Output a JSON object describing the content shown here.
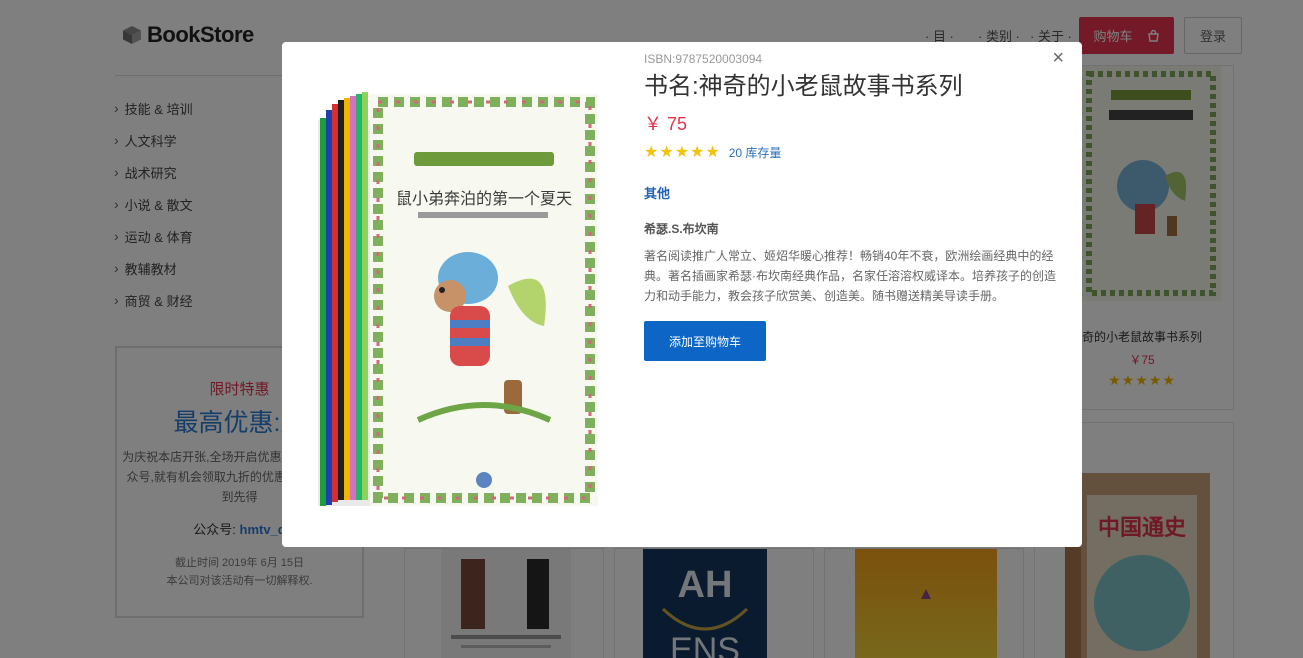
{
  "header": {
    "logo_text": "BookStore",
    "nav_items": [
      "· 目 ·",
      "· 类别 ·",
      "· 关于 ·"
    ],
    "cart_label": "购物车",
    "login_label": "登录"
  },
  "sidebar": {
    "categories": [
      "技能 & 培训",
      "人文科学",
      "战术研究",
      "小说 & 散文",
      "运动 & 体育",
      "教辅教材",
      "商贸 & 财经"
    ]
  },
  "promo": {
    "tag": "限时特惠",
    "title": "最高优惠:九",
    "body": "为庆祝本店开张,全场开启优惠,加我们客服公众号,就有机会领取九折的优惠,机会有限,先到先得",
    "wechat_label": "公众号:",
    "wechat_id": "hmtv_q",
    "deadline": "截止时间 2019年 6月 15日",
    "disclaimer": "本公司对该活动有一切解释权."
  },
  "right_card": {
    "title": "奇的小老鼠故事书系列",
    "price": "￥75",
    "rating": 5
  },
  "modal": {
    "isbn": "ISBN:9787520003094",
    "title": "书名:神奇的小老鼠故事书系列",
    "price": "￥ 75",
    "rating": 5,
    "stock": "20 库存量",
    "category": "其他",
    "author": "希瑟.S.布坎南",
    "description": "著名阅读推广人常立、姬炤华暖心推荐！畅销40年不衰，欧洲绘画经典中的经典。著名插画家希瑟·布坎南经典作品，名家任溶溶权威译本。培养孩子的创造力和动手能力，教会孩子欣赏美、创造美。随书赠送精美导读手册。",
    "add_to_cart_label": "添加至购物车",
    "close_icon": "×",
    "cover_text": "鼠小弟奔泊的第一个夏天",
    "colors": {
      "accent": "#e8334f",
      "primary": "#0d66c6",
      "star": "#f4c20d"
    }
  }
}
